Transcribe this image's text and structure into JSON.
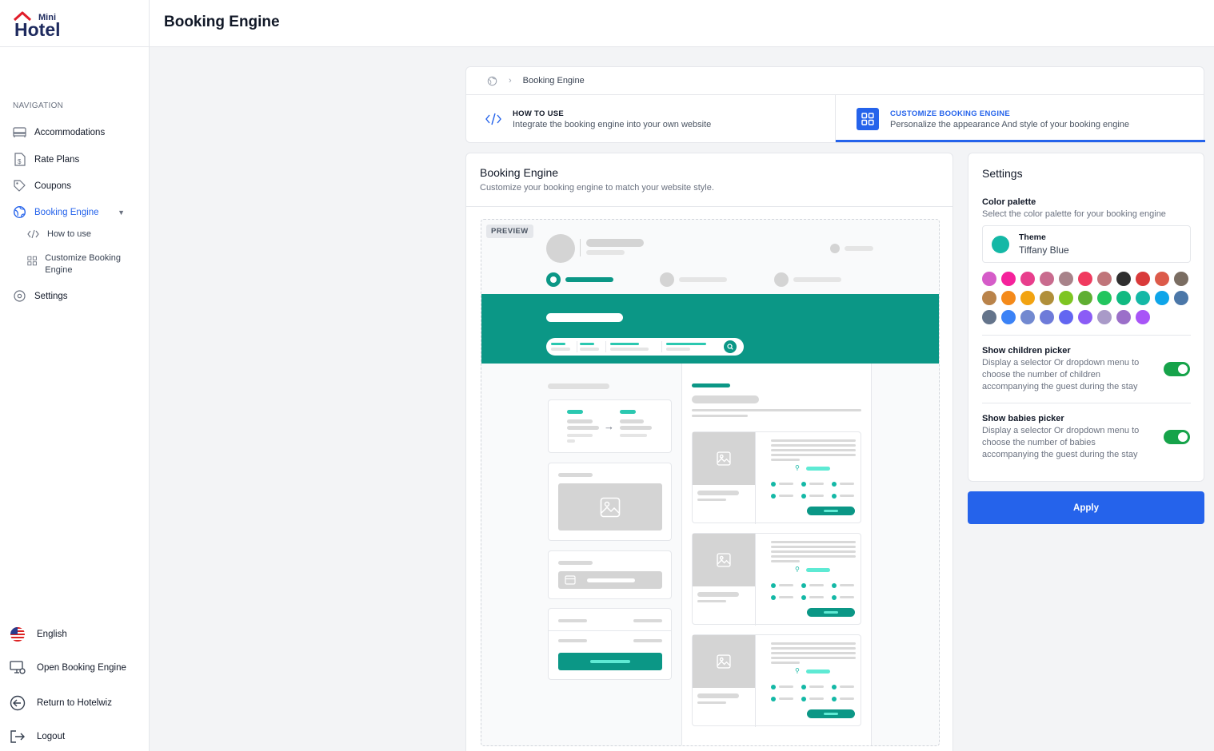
{
  "app": {
    "logo_top": "Mini",
    "logo_main": "Hotel",
    "page_title": "Booking Engine"
  },
  "sidebar": {
    "nav_label": "NAVIGATION",
    "items": [
      {
        "label": "Accommodations",
        "icon": "bed-icon"
      },
      {
        "label": "Rate Plans",
        "icon": "document-dollar-icon"
      },
      {
        "label": "Coupons",
        "icon": "tag-icon"
      },
      {
        "label": "Booking Engine",
        "icon": "globe-icon",
        "active": true
      },
      {
        "label": "Settings",
        "icon": "gear-icon"
      }
    ],
    "sub_items": [
      {
        "label": "How to use",
        "icon": "code-icon"
      },
      {
        "label": "Customize Booking Engine",
        "icon": "grid-icon"
      }
    ],
    "bottom": [
      {
        "label": "English",
        "icon": "us-flag-icon"
      },
      {
        "label": "Open Booking Engine",
        "icon": "monitor-gear-icon"
      },
      {
        "label": "Return to Hotelwiz",
        "icon": "arrow-left-circle-icon"
      },
      {
        "label": "Logout",
        "icon": "logout-icon"
      }
    ]
  },
  "breadcrumb": {
    "current": "Booking Engine"
  },
  "tabs": [
    {
      "title": "HOW TO USE",
      "desc": "Integrate the booking engine into your own website"
    },
    {
      "title": "CUSTOMIZE BOOKING ENGINE",
      "desc": "Personalize the appearance And style of your booking engine",
      "active": true
    }
  ],
  "main": {
    "title": "Booking Engine",
    "subtitle": "Customize your booking engine to match your website style.",
    "preview_badge": "PREVIEW"
  },
  "settings": {
    "title": "Settings",
    "palette_title": "Color palette",
    "palette_desc": "Select the color palette for your booking engine",
    "theme_label": "Theme",
    "theme_value": "Tiffany Blue",
    "theme_color": "#14b8a6",
    "palette": [
      "#d55cc8",
      "#f5229b",
      "#e83e8c",
      "#c96b8e",
      "#a8838a",
      "#f03a5f",
      "#c0757a",
      "#2f2f2f",
      "#d93a3a",
      "#dc5a4a",
      "#7a6d62",
      "#b9834a",
      "#f48a1a",
      "#f2a311",
      "#b08f3a",
      "#7ec522",
      "#5fae32",
      "#22c55e",
      "#10b981",
      "#14b8a6",
      "#0ea5e9",
      "#4b77a8",
      "#64748b",
      "#3b82f6",
      "#7289d0",
      "#6e7bd9",
      "#6366f1",
      "#8b5cf6",
      "#a99ac8",
      "#9b6fc9",
      "#a855f7"
    ],
    "children_title": "Show children picker",
    "children_desc": "Display a selector Or dropdown menu to choose the number of children accompanying the guest during the stay",
    "children_on": true,
    "babies_title": "Show babies picker",
    "babies_desc": "Display a selector Or dropdown menu to choose the number of babies accompanying the guest during the stay",
    "babies_on": true,
    "apply_label": "Apply"
  },
  "colors": {
    "accent": "#2563eb",
    "brand_teal": "#0b9786",
    "toggle_on": "#16a34a"
  }
}
